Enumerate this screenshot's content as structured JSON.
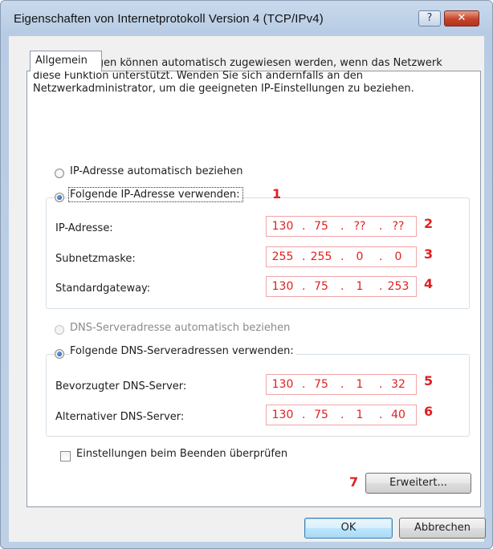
{
  "window": {
    "title": "Eigenschaften von Internetprotokoll Version 4 (TCP/IPv4)",
    "help_label": "?",
    "close_label": "✕"
  },
  "tabs": [
    {
      "label": "Allgemein"
    }
  ],
  "intro_text": "IP-Einstellungen können automatisch zugewiesen werden, wenn das Netzwerk diese Funktion unterstützt. Wenden Sie sich andernfalls an den Netzwerkadministrator, um die geeigneten IP-Einstellungen zu beziehen.",
  "ip_section": {
    "auto_label": "IP-Adresse automatisch beziehen",
    "manual_label": "Folgende IP-Adresse verwenden:",
    "selected": "manual",
    "fields": [
      {
        "label": "IP-Adresse:",
        "octets": [
          "130",
          "75",
          "??",
          "??"
        ]
      },
      {
        "label": "Subnetzmaske:",
        "octets": [
          "255",
          "255",
          "0",
          "0"
        ]
      },
      {
        "label": "Standardgateway:",
        "octets": [
          "130",
          "75",
          "1",
          "253"
        ]
      }
    ]
  },
  "dns_section": {
    "auto_label": "DNS-Serveradresse automatisch beziehen",
    "manual_label": "Folgende DNS-Serveradressen verwenden:",
    "selected": "manual",
    "fields": [
      {
        "label": "Bevorzugter DNS-Server:",
        "octets": [
          "130",
          "75",
          "1",
          "32"
        ]
      },
      {
        "label": "Alternativer DNS-Server:",
        "octets": [
          "130",
          "75",
          "1",
          "40"
        ]
      }
    ]
  },
  "validate_checkbox": {
    "label": "Einstellungen beim Beenden überprüfen",
    "checked": false
  },
  "advanced_button": "Erweitert...",
  "ok_button": "OK",
  "cancel_button": "Abbrechen",
  "annotations": [
    "1",
    "2",
    "3",
    "4",
    "5",
    "6",
    "7"
  ],
  "colors": {
    "annotation": "#e02020",
    "field_border": "#f0a5a5",
    "title_bar": "#b7cce4"
  }
}
